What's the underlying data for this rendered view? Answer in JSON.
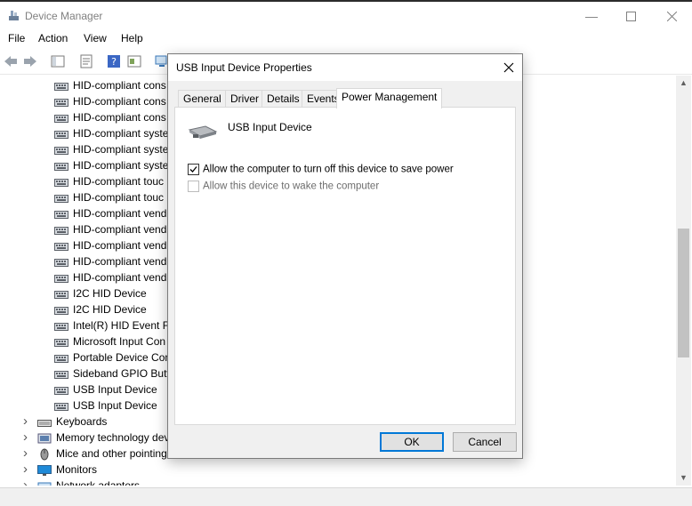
{
  "window": {
    "title": "Device Manager"
  },
  "menu": [
    "File",
    "Action",
    "View",
    "Help"
  ],
  "tree": {
    "hid_items": [
      "HID-compliant cons",
      "HID-compliant cons",
      "HID-compliant cons",
      "HID-compliant syste",
      "HID-compliant syste",
      "HID-compliant syste",
      "HID-compliant touc",
      "HID-compliant touc",
      "HID-compliant vend",
      "HID-compliant vend",
      "HID-compliant vend",
      "HID-compliant vend",
      "HID-compliant vend",
      "I2C HID Device",
      "I2C HID Device",
      "Intel(R) HID Event Fi",
      "Microsoft Input Con",
      "Portable Device Con",
      "Sideband GPIO Butto",
      "USB Input Device",
      "USB Input Device"
    ],
    "categories": [
      {
        "label": "Keyboards",
        "icon": "keyboard-icon"
      },
      {
        "label": "Memory technology dev",
        "icon": "memory-icon"
      },
      {
        "label": "Mice and other pointing",
        "icon": "mouse-icon"
      },
      {
        "label": "Monitors",
        "icon": "monitor-icon"
      },
      {
        "label": "Network adapters",
        "icon": "network-icon"
      }
    ]
  },
  "dialog": {
    "title": "USB Input Device Properties",
    "tabs": [
      "General",
      "Driver",
      "Details",
      "Events",
      "Power Management"
    ],
    "active_tab": "Power Management",
    "device_name": "USB Input Device",
    "options": [
      {
        "label": "Allow the computer to turn off this device to save power",
        "checked": true,
        "enabled": true
      },
      {
        "label": "Allow this device to wake the computer",
        "checked": false,
        "enabled": false
      }
    ],
    "ok_label": "OK",
    "cancel_label": "Cancel"
  },
  "colors": {
    "accent": "#0078d7",
    "dialog_bg": "#f0f0f0"
  }
}
